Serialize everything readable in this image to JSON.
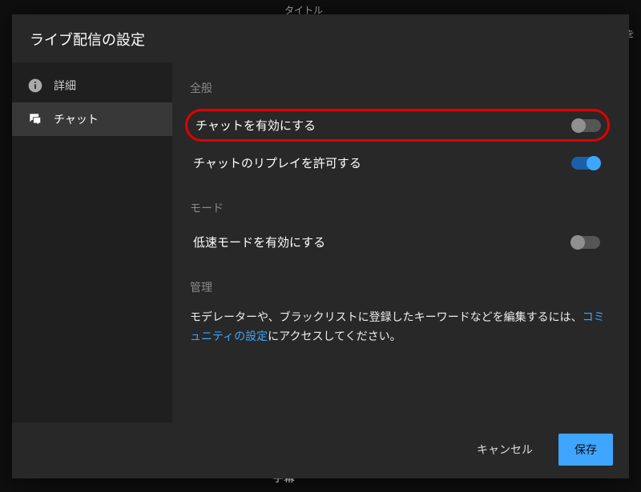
{
  "background": {
    "tab": "タイトル",
    "right_line1": "！",
    "right_line2": "ンを",
    "bottom": "字幕"
  },
  "dialog": {
    "title": "ライブ配信の設定",
    "sidebar": [
      {
        "label": "詳細",
        "icon": "info"
      },
      {
        "label": "チャット",
        "icon": "chat"
      }
    ],
    "sections": {
      "general": {
        "title": "全般",
        "enable_chat": "チャットを有効にする",
        "allow_replay": "チャットのリプレイを許可する"
      },
      "mode": {
        "title": "モード",
        "slow_mode": "低速モードを有効にする"
      },
      "manage": {
        "title": "管理",
        "desc_before": "モデレーターや、ブラックリストに登録したキーワードなどを編集するには、",
        "link": "コミュニティの設定",
        "desc_after": "にアクセスしてください。"
      }
    },
    "footer": {
      "cancel": "キャンセル",
      "save": "保存"
    }
  },
  "toggles": {
    "enable_chat": false,
    "allow_replay": true,
    "slow_mode": false
  }
}
